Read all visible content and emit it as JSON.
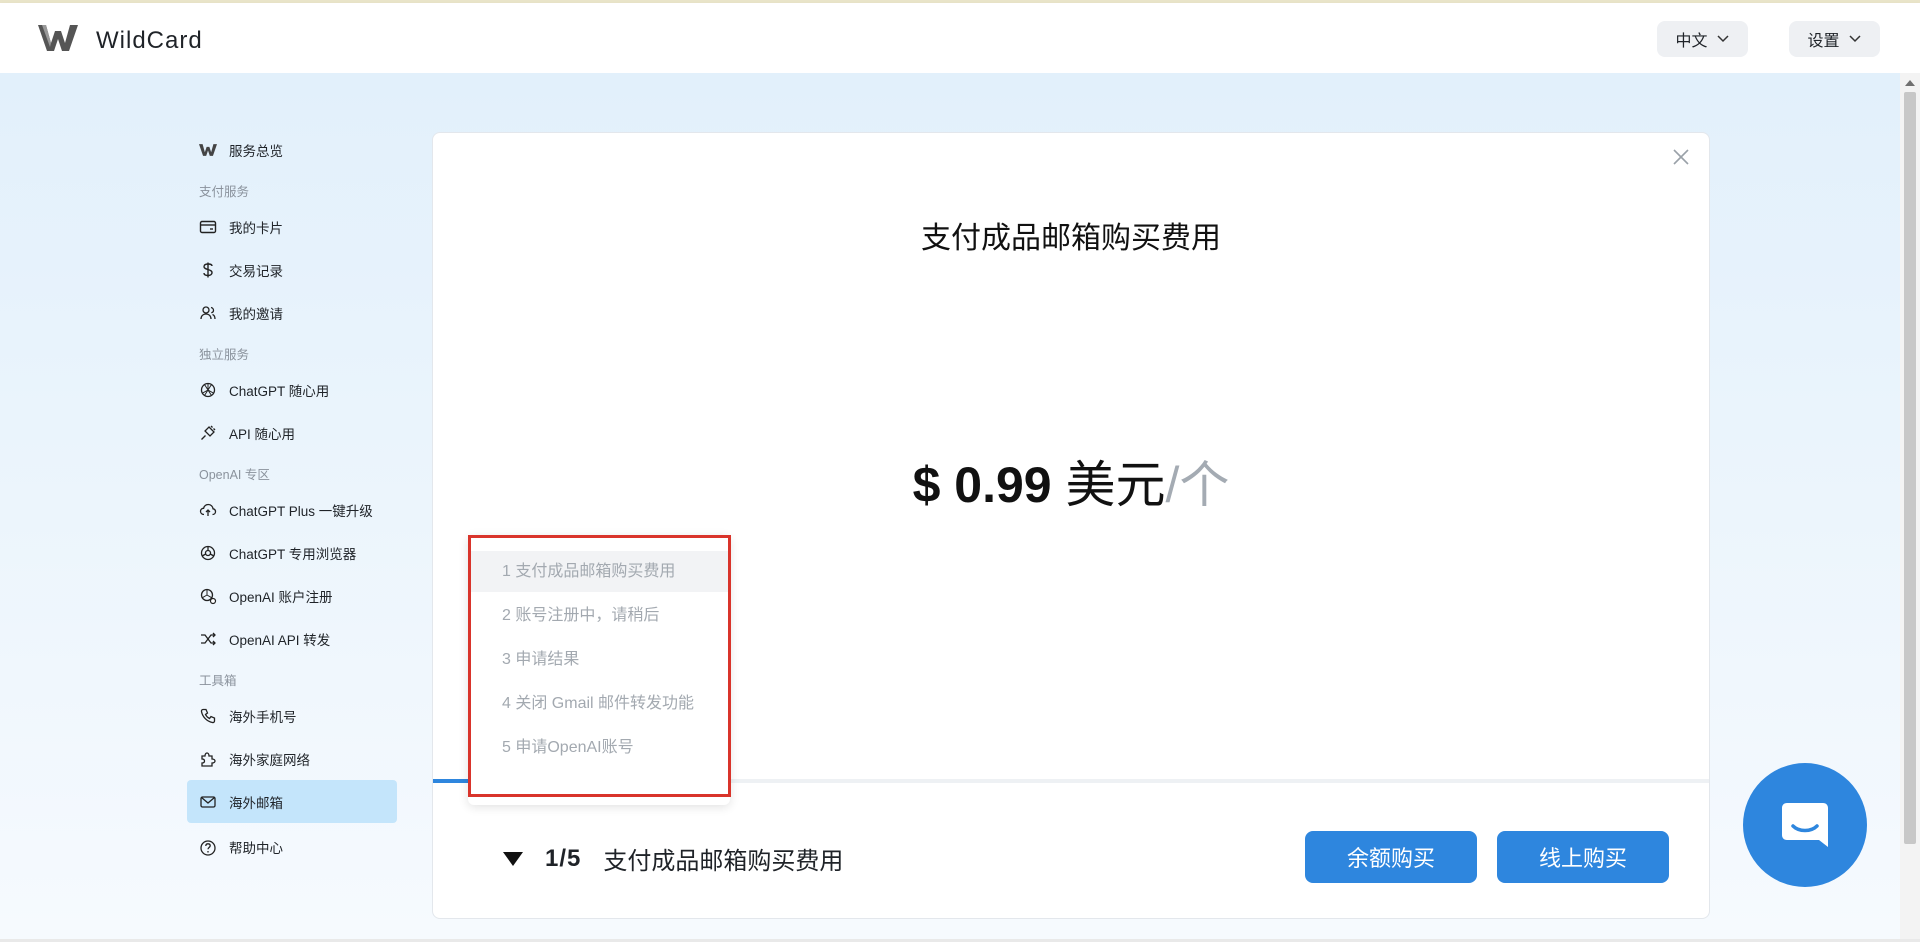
{
  "header": {
    "brand": "WildCard",
    "language_label": "中文",
    "settings_label": "设置"
  },
  "sidebar": {
    "overview_label": "服务总览",
    "sections": [
      {
        "title": "支付服务",
        "items": [
          {
            "label": "我的卡片",
            "icon": "card-icon"
          },
          {
            "label": "交易记录",
            "icon": "dollar-icon"
          },
          {
            "label": "我的邀请",
            "icon": "users-icon"
          }
        ]
      },
      {
        "title": "独立服务",
        "items": [
          {
            "label": "ChatGPT 随心用",
            "icon": "openai-icon"
          },
          {
            "label": "API 随心用",
            "icon": "plug-icon"
          }
        ]
      },
      {
        "title": "OpenAI 专区",
        "items": [
          {
            "label": "ChatGPT Plus 一键升级",
            "icon": "cloud-upload-icon"
          },
          {
            "label": "ChatGPT 专用浏览器",
            "icon": "browser-icon"
          },
          {
            "label": "OpenAI 账户注册",
            "icon": "account-register-icon"
          },
          {
            "label": "OpenAI API 转发",
            "icon": "shuffle-icon"
          }
        ]
      },
      {
        "title": "工具箱",
        "items": [
          {
            "label": "海外手机号",
            "icon": "phone-icon"
          },
          {
            "label": "海外家庭网络",
            "icon": "puzzle-icon"
          },
          {
            "label": "海外邮箱",
            "icon": "mail-icon",
            "active": true
          },
          {
            "label": "帮助中心",
            "icon": "help-icon"
          }
        ]
      }
    ]
  },
  "panel": {
    "title": "支付成品邮箱购买费用",
    "price_amount": "$ 0.99",
    "price_currency": " 美元",
    "price_unit": "/个",
    "progress_fraction": 0.2,
    "step_count": "1/5",
    "step_label": "支付成品邮箱购买费用",
    "balance_button": "余额购买",
    "online_button": "线上购买"
  },
  "steps_menu": [
    "1 支付成品邮箱购买费用",
    "2 账号注册中，请稍后",
    "3 申请结果",
    "4 关闭 Gmail 邮件转发功能",
    "5 申请OpenAI账号"
  ],
  "colors": {
    "accent": "#2e86de",
    "active_nav": "#c4e5fb",
    "highlight": "#d9342b"
  }
}
